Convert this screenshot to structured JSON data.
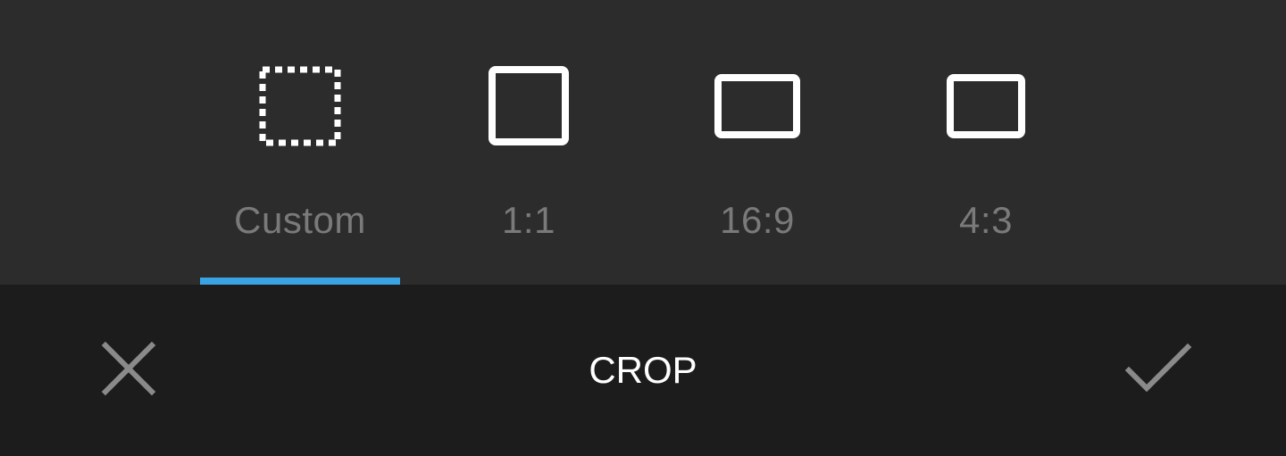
{
  "ratio_tabs": [
    {
      "label": "Custom",
      "icon": "dotted-crop-icon",
      "selected": true
    },
    {
      "label": "1:1",
      "icon": "square-icon",
      "selected": false
    },
    {
      "label": "16:9",
      "icon": "wide-rectangle-icon",
      "selected": false
    },
    {
      "label": "4:3",
      "icon": "rectangle-icon",
      "selected": false
    }
  ],
  "toolbar": {
    "title": "CROP",
    "cancel_icon": "close-icon",
    "confirm_icon": "check-icon"
  },
  "colors": {
    "panel_bg": "#2c2c2c",
    "bar_bg": "#1c1c1c",
    "indicator": "#3aa3e3",
    "label": "#7a7a7a",
    "icon": "#ffffff",
    "action_icon": "#8a8a8a"
  }
}
